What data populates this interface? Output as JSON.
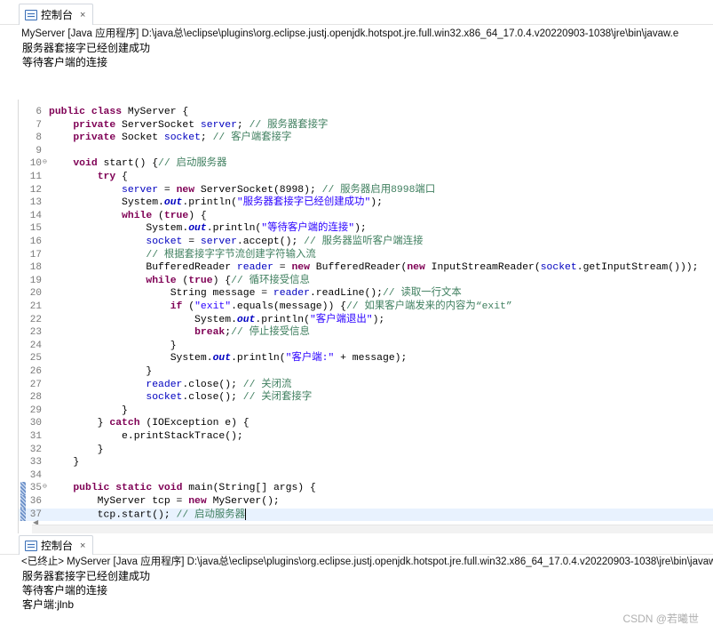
{
  "console_top": {
    "tab_label": "控制台",
    "close_glyph": "×",
    "title": "MyServer [Java 应用程序] D:\\java总\\eclipse\\plugins\\org.eclipse.justj.openjdk.hotspot.jre.full.win32.x86_64_17.0.4.v20220903-1038\\jre\\bin\\javaw.e",
    "lines": [
      "服务器套接字已经创建成功",
      "等待客户端的连接"
    ]
  },
  "editor": {
    "lines": [
      {
        "num": "6",
        "text": "public class MyServer {"
      },
      {
        "num": "7",
        "text": "    private ServerSocket server; // 服务器套接字"
      },
      {
        "num": "8",
        "text": "    private Socket socket; // 客户端套接字"
      },
      {
        "num": "9",
        "text": ""
      },
      {
        "num": "10",
        "text": "    void start() {// 启动服务器"
      },
      {
        "num": "11",
        "text": "        try {"
      },
      {
        "num": "12",
        "text": "            server = new ServerSocket(8998); // 服务器启用8998端口"
      },
      {
        "num": "13",
        "text": "            System.out.println(\"服务器套接字已经创建成功\");"
      },
      {
        "num": "14",
        "text": "            while (true) {"
      },
      {
        "num": "15",
        "text": "                System.out.println(\"等待客户端的连接\");"
      },
      {
        "num": "16",
        "text": "                socket = server.accept(); // 服务器监听客户端连接"
      },
      {
        "num": "17",
        "text": "                // 根据套接字字节流创建字符输入流"
      },
      {
        "num": "18",
        "text": "                BufferedReader reader = new BufferedReader(new InputStreamReader(socket.getInputStream()));"
      },
      {
        "num": "19",
        "text": "                while (true) {// 循环接受信息"
      },
      {
        "num": "20",
        "text": "                    String message = reader.readLine();// 读取一行文本"
      },
      {
        "num": "21",
        "text": "                    if (\"exit\".equals(message)) {// 如果客户端发来的内容为“exit”"
      },
      {
        "num": "22",
        "text": "                        System.out.println(\"客户端退出\");"
      },
      {
        "num": "23",
        "text": "                        break;// 停止接受信息"
      },
      {
        "num": "24",
        "text": "                    }"
      },
      {
        "num": "25",
        "text": "                    System.out.println(\"客户端:\" + message);"
      },
      {
        "num": "26",
        "text": "                }"
      },
      {
        "num": "27",
        "text": "                reader.close(); // 关闭流"
      },
      {
        "num": "28",
        "text": "                socket.close(); // 关闭套接字"
      },
      {
        "num": "29",
        "text": "            }"
      },
      {
        "num": "30",
        "text": "        } catch (IOException e) {"
      },
      {
        "num": "31",
        "text": "            e.printStackTrace();"
      },
      {
        "num": "32",
        "text": "        }"
      },
      {
        "num": "33",
        "text": "    }"
      },
      {
        "num": "34",
        "text": ""
      },
      {
        "num": "35",
        "text": "    public static void main(String[] args) {"
      },
      {
        "num": "36",
        "text": "        MyServer tcp = new MyServer();"
      },
      {
        "num": "37",
        "text": "        tcp.start(); // 启动服务器"
      }
    ]
  },
  "console_bottom": {
    "tab_label": "控制台",
    "close_glyph": "×",
    "title": "<已终止> MyServer [Java 应用程序] D:\\java总\\eclipse\\plugins\\org.eclipse.justj.openjdk.hotspot.jre.full.win32.x86_64_17.0.4.v20220903-1038\\jre\\bin\\javaw.e",
    "lines": [
      "服务器套接字已经创建成功",
      "等待客户端的连接",
      "客户端:jlnb"
    ]
  },
  "watermark": "CSDN @若曦世"
}
